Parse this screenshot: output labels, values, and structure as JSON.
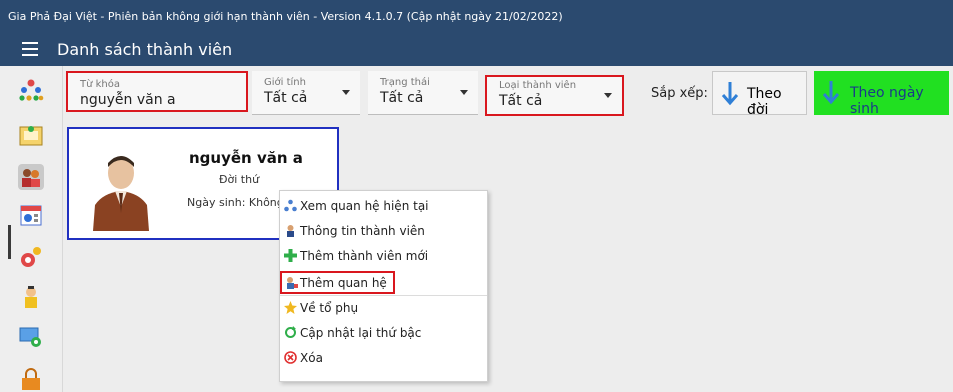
{
  "window": {
    "title": "Gia Phả Đại Việt - Phiên bản không giới hạn thành viên - Version 4.1.0.7 (Cập nhật ngày 21/02/2022)"
  },
  "header": {
    "title": "Danh sách thành viên",
    "menu_icon": "hamburger-icon"
  },
  "sidebar": {
    "icons": [
      "family-tree-icon",
      "certificate-icon",
      "members-icon",
      "calendar-icon",
      "settings-icon",
      "user-support-icon",
      "screen-sync-icon",
      "lock-icon"
    ],
    "active_index": 2
  },
  "filters": {
    "keyword": {
      "label": "Từ khóa",
      "value": "nguyễn văn a"
    },
    "gender": {
      "label": "Giới tính",
      "value": "Tất cả"
    },
    "status": {
      "label": "Trạng thái",
      "value": "Tất cả"
    },
    "member_type": {
      "label": "Loại thành viên",
      "value": "Tất cả"
    }
  },
  "sort": {
    "label": "Sắp xếp:",
    "by_generation": "Theo đời",
    "by_birthdate": "Theo ngày sinh"
  },
  "member_card": {
    "name": "nguyễn văn a",
    "generation": "Đời thứ",
    "birth": "Ngày sinh: Không"
  },
  "context_menu": {
    "items": [
      {
        "label": "Xem quan hệ hiện tại",
        "icon": "relationship-icon"
      },
      {
        "label": "Thông tin thành viên",
        "icon": "info-icon"
      },
      {
        "label": "Thêm thành viên mới",
        "icon": "plus-icon"
      },
      {
        "label": "Thêm quan hệ",
        "icon": "add-relation-icon"
      },
      {
        "label": "Về tổ phụ",
        "icon": "ancestor-icon"
      },
      {
        "label": "Cập nhật lại thứ bậc",
        "icon": "refresh-icon"
      },
      {
        "label": "Xóa",
        "icon": "delete-icon"
      }
    ]
  },
  "colors": {
    "titlebar": "#2b4a6f",
    "highlight": "#d9171e",
    "sort_active": "#21e021",
    "card_border": "#2030c0"
  }
}
